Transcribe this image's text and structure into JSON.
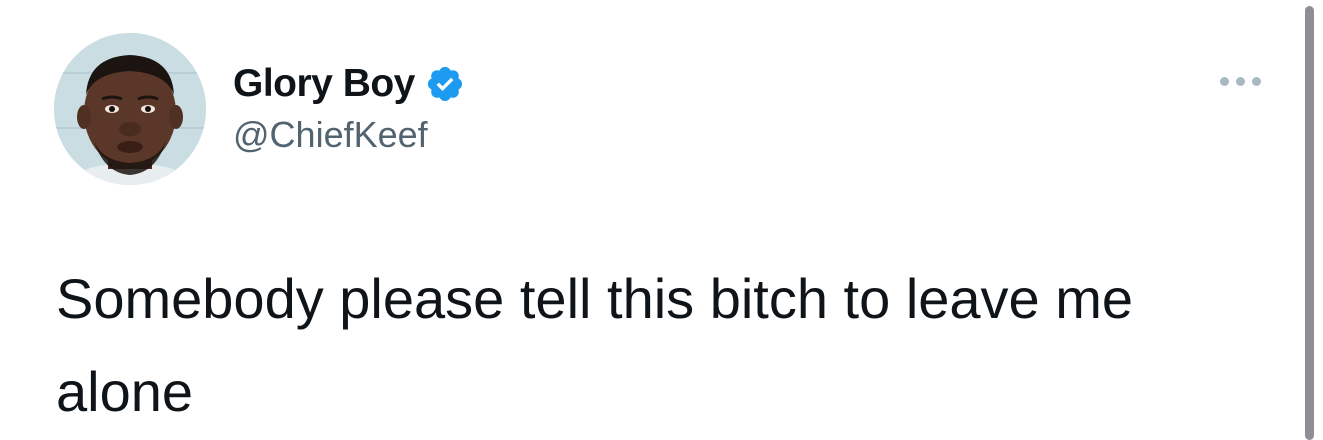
{
  "tweet": {
    "author": {
      "display_name": "Glory Boy",
      "handle": "@ChiefKeef",
      "verified": true,
      "avatar_icon": "profile-photo"
    },
    "more_icon": "more-horizontal-icon",
    "text": "Somebody please tell this bitch to leave me alone"
  },
  "colors": {
    "verified_blue": "#1d9bf0",
    "handle_gray": "#536471",
    "text": "#0f1419",
    "more_dots": "#aab8c2"
  }
}
